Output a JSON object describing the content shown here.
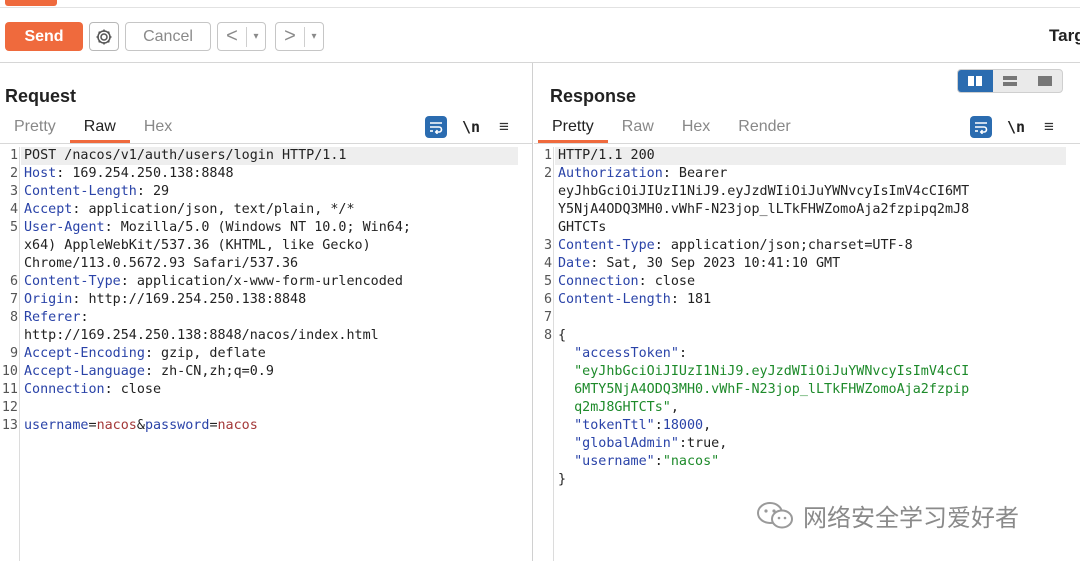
{
  "toolbar": {
    "send_label": "Send",
    "cancel_label": "Cancel",
    "back_glyph": "<",
    "forward_glyph": ">",
    "dropdown_glyph": "▾",
    "target_label": "Targ"
  },
  "request": {
    "title": "Request",
    "tabs": [
      "Pretty",
      "Raw",
      "Hex"
    ],
    "active_tab": "Raw",
    "nl_icon": "\\n",
    "menu_icon": "≡",
    "lines": [
      {
        "n": "1",
        "text": "POST /nacos/v1/auth/users/login HTTP/1.1"
      },
      {
        "n": "2",
        "key": "Host",
        "val": " 169.254.250.138:8848"
      },
      {
        "n": "3",
        "key": "Content-Length",
        "val": " 29"
      },
      {
        "n": "4",
        "key": "Accept",
        "val": " application/json, text/plain, */*"
      },
      {
        "n": "5",
        "key": "User-Agent",
        "val": " Mozilla/5.0 (Windows NT 10.0; Win64;"
      },
      {
        "n": "",
        "text": "x64) AppleWebKit/537.36 (KHTML, like Gecko)"
      },
      {
        "n": "",
        "text": "Chrome/113.0.5672.93 Safari/537.36"
      },
      {
        "n": "6",
        "key": "Content-Type",
        "val": " application/x-www-form-urlencoded"
      },
      {
        "n": "7",
        "key": "Origin",
        "val": " http://169.254.250.138:8848"
      },
      {
        "n": "8",
        "key": "Referer",
        "val": ""
      },
      {
        "n": "",
        "text": "http://169.254.250.138:8848/nacos/index.html"
      },
      {
        "n": "9",
        "key": "Accept-Encoding",
        "val": " gzip, deflate"
      },
      {
        "n": "10",
        "key": "Accept-Language",
        "val": " zh-CN,zh;q=0.9"
      },
      {
        "n": "11",
        "key": "Connection",
        "val": " close"
      },
      {
        "n": "12",
        "text": ""
      },
      {
        "n": "13",
        "body": [
          [
            "username",
            "k"
          ],
          [
            "=",
            "v"
          ],
          [
            "nacos",
            "p"
          ],
          [
            "&",
            "v"
          ],
          [
            "password",
            "k"
          ],
          [
            "=",
            "v"
          ],
          [
            "nacos",
            "p"
          ]
        ]
      }
    ]
  },
  "response": {
    "title": "Response",
    "tabs": [
      "Pretty",
      "Raw",
      "Hex",
      "Render"
    ],
    "active_tab": "Pretty",
    "nl_icon": "\\n",
    "menu_icon": "≡",
    "lines": [
      {
        "n": "1",
        "text": "HTTP/1.1 200"
      },
      {
        "n": "2",
        "key": "Authorization",
        "val": " Bearer"
      },
      {
        "n": "",
        "text": "eyJhbGciOiJIUzI1NiJ9.eyJzdWIiOiJuYWNvcyIsImV4cCI6MT"
      },
      {
        "n": "",
        "text": "Y5NjA4ODQ3MH0.vWhF-N23jop_lLTkFHWZomoAja2fzpipq2mJ8"
      },
      {
        "n": "",
        "text": "GHTCTs"
      },
      {
        "n": "3",
        "key": "Content-Type",
        "val": " application/json;charset=UTF-8"
      },
      {
        "n": "4",
        "key": "Date",
        "val": " Sat, 30 Sep 2023 10:41:10 GMT"
      },
      {
        "n": "5",
        "key": "Connection",
        "val": " close"
      },
      {
        "n": "6",
        "key": "Content-Length",
        "val": " 181"
      },
      {
        "n": "7",
        "text": ""
      },
      {
        "n": "8",
        "text": "{"
      },
      {
        "n": "",
        "json": [
          [
            "  \"accessToken\"",
            "k"
          ],
          [
            ":",
            "v"
          ]
        ]
      },
      {
        "n": "",
        "json": [
          [
            "  \"eyJhbGciOiJIUzI1NiJ9.eyJzdWIiOiJuYWNvcyIsImV4cCI",
            "s"
          ]
        ]
      },
      {
        "n": "",
        "json": [
          [
            "  6MTY5NjA4ODQ3MH0.vWhF-N23jop_lLTkFHWZomoAja2fzpip",
            "s"
          ]
        ]
      },
      {
        "n": "",
        "json": [
          [
            "  q2mJ8GHTCTs\"",
            "s"
          ],
          [
            ",",
            "v"
          ]
        ]
      },
      {
        "n": "",
        "json": [
          [
            "  \"tokenTtl\"",
            "k"
          ],
          [
            ":",
            "v"
          ],
          [
            "18000",
            "num"
          ],
          [
            ",",
            "v"
          ]
        ]
      },
      {
        "n": "",
        "json": [
          [
            "  \"globalAdmin\"",
            "k"
          ],
          [
            ":true,",
            "v"
          ]
        ]
      },
      {
        "n": "",
        "json": [
          [
            "  \"username\"",
            "k"
          ],
          [
            ":",
            "v"
          ],
          [
            "\"nacos\"",
            "s"
          ]
        ]
      },
      {
        "n": "",
        "text": "}"
      }
    ]
  },
  "watermark": {
    "text": "网络安全学习爱好者",
    "icon": "wechat-icon"
  },
  "colors": {
    "accent": "#ef6a3d",
    "blue": "#2b6cb0",
    "header_key": "#2a43a8",
    "string": "#1d8a2a",
    "param_value": "#a33838"
  }
}
